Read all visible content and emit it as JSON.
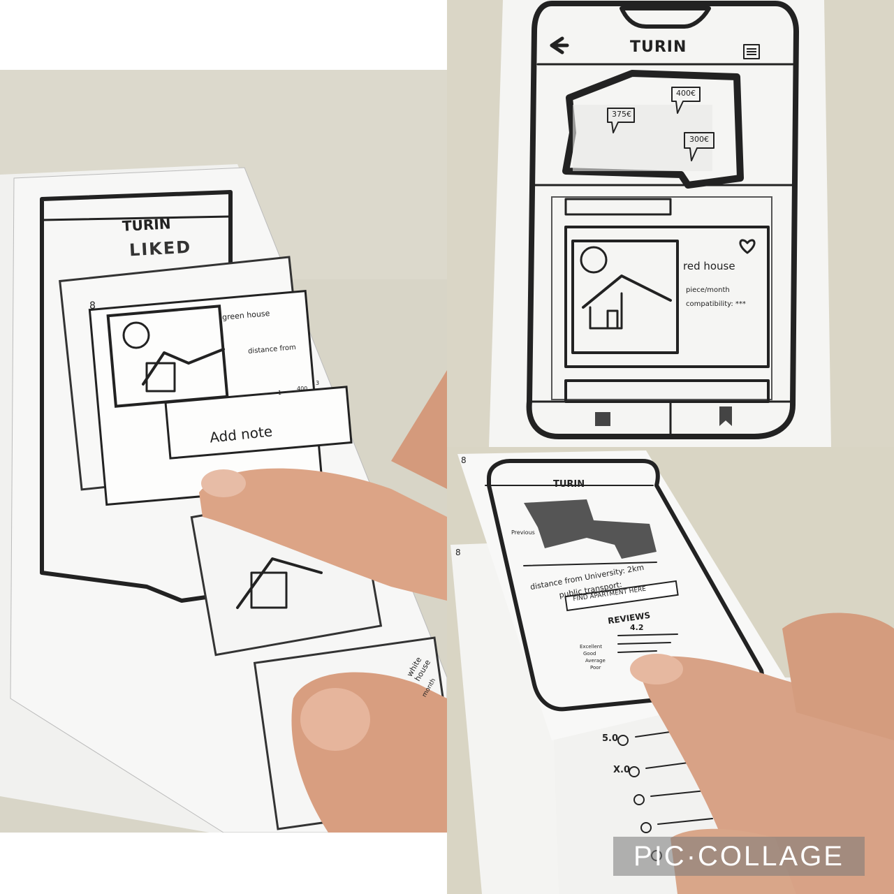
{
  "collage": {
    "watermark": "PIC·COLLAGE"
  },
  "left_photo": {
    "page_number_a": "8",
    "app_name": "TURIN",
    "screen_title": "LIKED",
    "card_title": "green house",
    "card_line": "distance from",
    "icon_caption_1": "1",
    "icon_caption_2": "400",
    "icon_caption_3": "3",
    "add_note": "Add note",
    "card2_title": "white house",
    "card2_line": "month"
  },
  "top_right_photo": {
    "app_name": "TURIN",
    "price_1": "375€",
    "price_2": "400€",
    "price_3": "300€",
    "card_title": "red house",
    "card_line_1": "piece/month",
    "card_line_2": "compatibility: ***"
  },
  "bottom_right_photo": {
    "page_number_a": "8",
    "page_number_b": "8",
    "app_name": "TURIN",
    "back_label": "Previous",
    "line_distance": "distance from University: 2km",
    "line_transport": "public transport:",
    "find_button": "FIND APARTMENT HERE",
    "reviews_title": "REVIEWS",
    "reviews_score": "4.2",
    "rating_1": "Excellent",
    "rating_2": "Good",
    "rating_3": "Average",
    "rating_4": "Poor",
    "review_score_1": "5.0",
    "review_score_x": "X.0"
  },
  "colors": {
    "table": "#d9d6c8",
    "table_dark": "#c9c5b4",
    "paper": "#f4f4f2",
    "ink": "#222222",
    "skin": "#e0a98a"
  }
}
